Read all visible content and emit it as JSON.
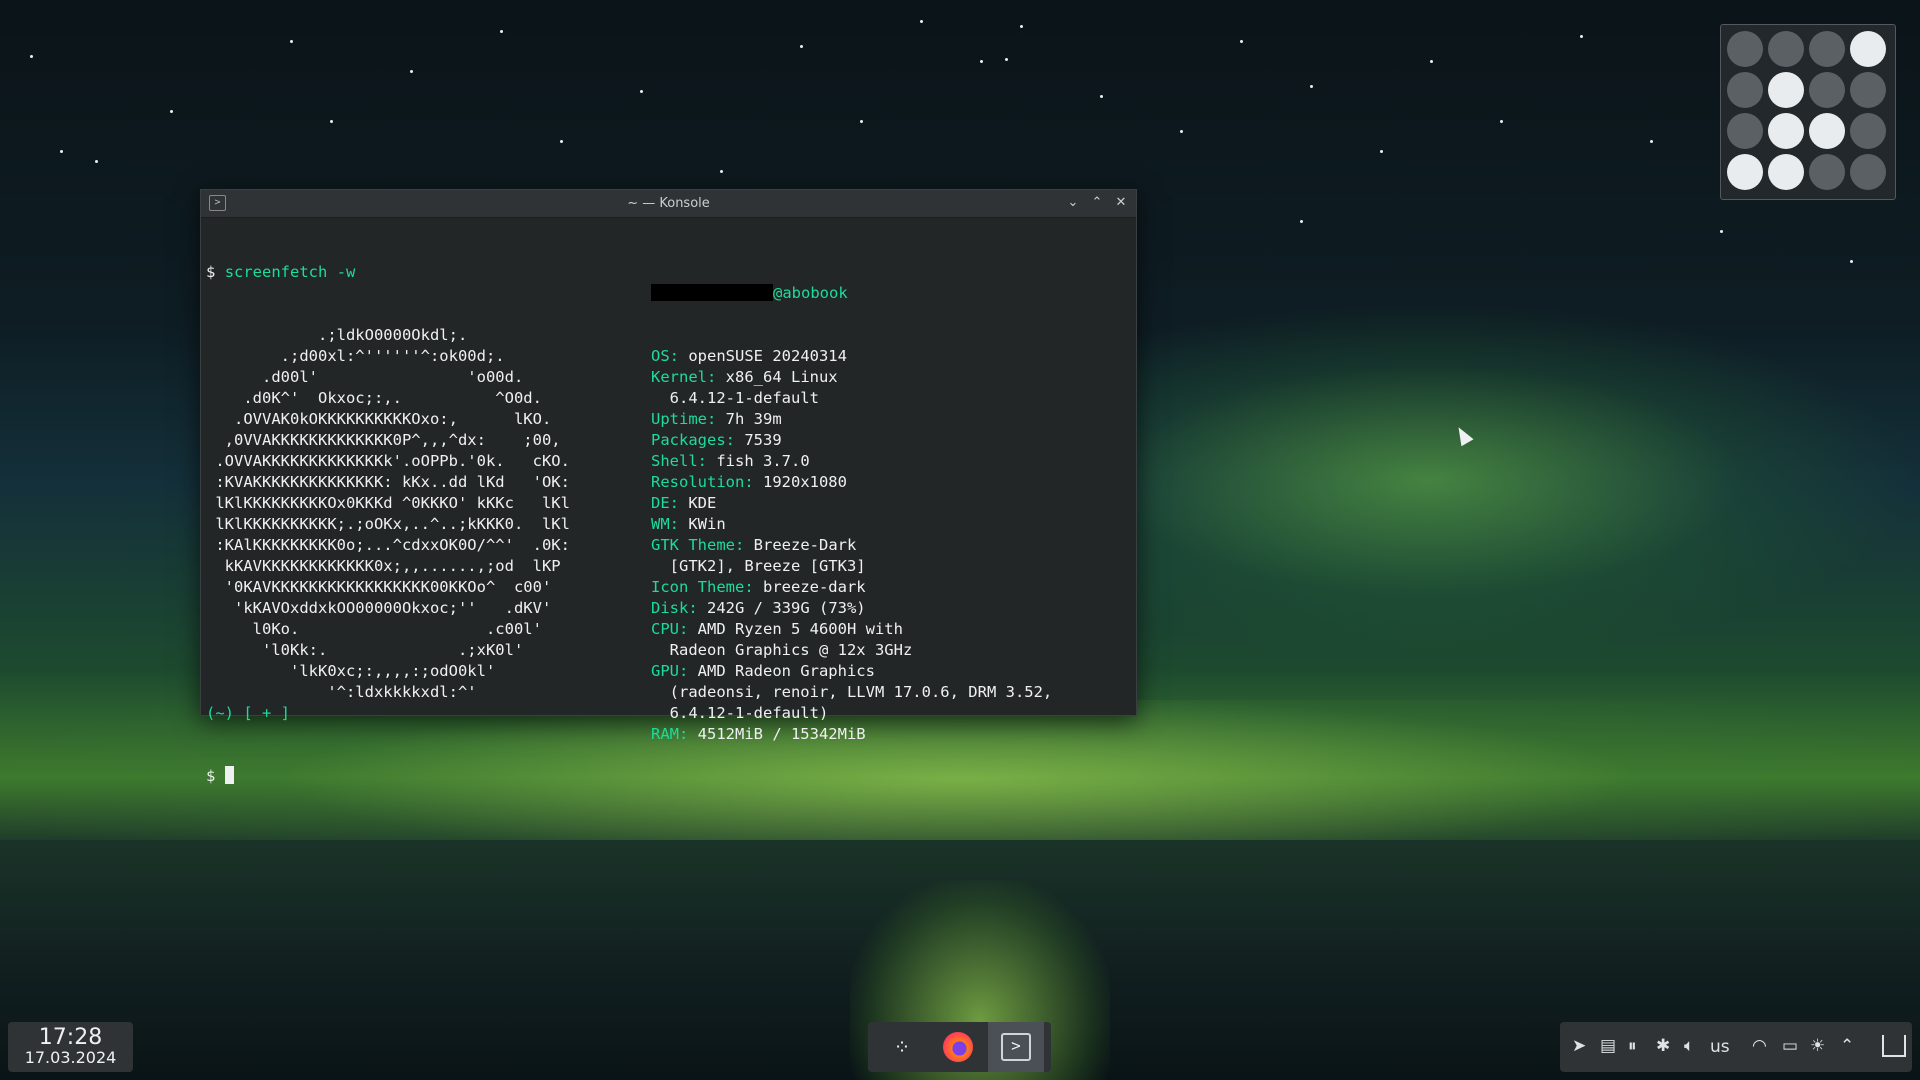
{
  "window": {
    "title": "~ — Konsole",
    "buttons": {
      "minimize": "⌄",
      "maximize": "⌃",
      "close": "✕"
    }
  },
  "terminal": {
    "prompt_symbol": "$",
    "command": "screenfetch",
    "command_arg": "-w",
    "art": [
      "            .;ldkO0000Okdl;.",
      "        .;d00xl:^''''''^:ok00d;.",
      "      .d00l'                'o00d.",
      "    .d0K^'  Okxoc;:,.          ^O0d.",
      "   .OVVAK0kOKKKKKKKKKKOxo:,      lKO.",
      "  ,0VVAKKKKKKKKKKKKK0P^,,,^dx:    ;00,",
      " .OVVAKKKKKKKKKKKKKk'.oOPPb.'0k.   cKO.",
      " :KVAKKKKKKKKKKKKKK: kKx..dd lKd   'OK:",
      " lKlKKKKKKKKKOx0KKKd ^0KKKO' kKKc   lKl",
      " lKlKKKKKKKKKK;.;oOKx,..^..;kKKK0.  lKl",
      " :KAlKKKKKKKKK0o;...^cdxxOK0O/^^'  .0K:",
      "  kKAVKKKKKKKKKKKK0x;,,......,;od  lKP",
      "  '0KAVKKKKKKKKKKKKKKKKK00KKOo^  c00'",
      "   'kKAVOxddxkOO00000Okxoc;''   .dKV'",
      "     l0Ko.                    .c00l'",
      "      'l0Kk:.              .;xK0l'",
      "         'lkK0xc;:,,,,:;odO0kl'",
      "             '^:ldxkkkkxdl:^'"
    ],
    "host": "@abobook",
    "info": [
      {
        "key": "OS:",
        "value": " openSUSE 20240314"
      },
      {
        "key": "Kernel:",
        "value": " x86_64 Linux"
      },
      {
        "key": "",
        "value": "  6.4.12-1-default"
      },
      {
        "key": "Uptime:",
        "value": " 7h 39m"
      },
      {
        "key": "Packages:",
        "value": " 7539"
      },
      {
        "key": "Shell:",
        "value": " fish 3.7.0"
      },
      {
        "key": "Resolution:",
        "value": " 1920x1080"
      },
      {
        "key": "DE:",
        "value": " KDE"
      },
      {
        "key": "WM:",
        "value": " KWin"
      },
      {
        "key": "GTK Theme:",
        "value": " Breeze-Dark"
      },
      {
        "key": "",
        "value": "  [GTK2], Breeze [GTK3]"
      },
      {
        "key": "Icon Theme:",
        "value": " breeze-dark"
      },
      {
        "key": "Disk:",
        "value": " 242G / 339G (73%)"
      },
      {
        "key": "CPU:",
        "value": " AMD Ryzen 5 4600H with"
      },
      {
        "key": "",
        "value": "  Radeon Graphics @ 12x 3GHz"
      },
      {
        "key": "GPU:",
        "value": " AMD Radeon Graphics"
      },
      {
        "key": "",
        "value": "  (radeonsi, renoir, LLVM 17.0.6, DRM 3.52,"
      },
      {
        "key": "",
        "value": "  6.4.12-1-default)"
      },
      {
        "key": "RAM:",
        "value": " 4512MiB / 15342MiB"
      }
    ],
    "fish_prompt": "(~) [ + ]",
    "prompt2": "$"
  },
  "pager": {
    "desktops": [
      [
        false,
        false,
        false,
        true
      ],
      [
        false,
        true,
        false,
        false
      ],
      [
        false,
        true,
        true,
        false
      ],
      [
        true,
        true,
        false,
        false
      ]
    ]
  },
  "clock": {
    "time": "17:28",
    "date": "17.03.2024"
  },
  "tray": {
    "keyboard_layout": "us"
  },
  "colors": {
    "accent_green": "#1cdc9a",
    "panel": "#2f3336",
    "terminal_bg": "#232627"
  }
}
